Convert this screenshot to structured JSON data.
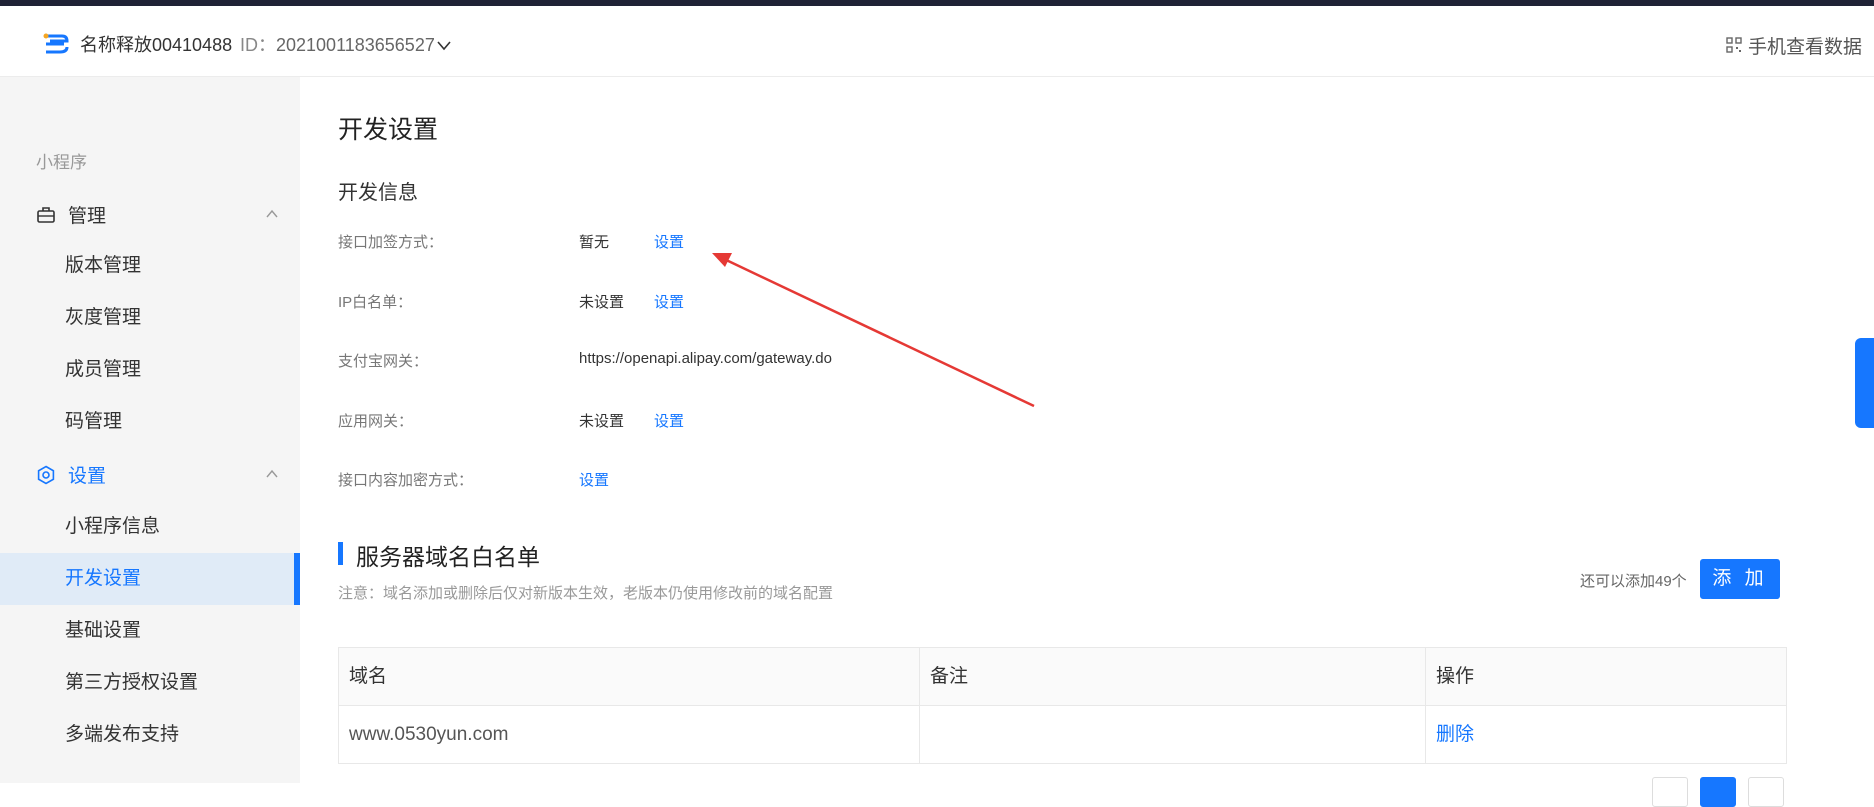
{
  "header": {
    "app_name": "名称释放00410488",
    "id_label": "ID：",
    "id_value": "2021001183656527",
    "mobile_view": "手机查看数据"
  },
  "sidebar": {
    "section": "小程序",
    "groups": [
      {
        "label": "管理",
        "items": [
          "版本管理",
          "灰度管理",
          "成员管理",
          "码管理"
        ]
      },
      {
        "label": "设置",
        "items": [
          "小程序信息",
          "开发设置",
          "基础设置",
          "第三方授权设置",
          "多端发布支持"
        ]
      }
    ],
    "active_item": "开发设置"
  },
  "main": {
    "page_title": "开发设置",
    "dev_info_title": "开发信息",
    "rows": [
      {
        "label": "接口加签方式：",
        "value": "暂无",
        "link": "设置"
      },
      {
        "label": "IP白名单：",
        "value": "未设置",
        "link": "设置"
      },
      {
        "label": "支付宝网关：",
        "value": "https://openapi.alipay.com/gateway.do",
        "link": ""
      },
      {
        "label": "应用网关：",
        "value": "未设置",
        "link": "设置"
      },
      {
        "label": "接口内容加密方式：",
        "value": "",
        "link": "设置"
      }
    ],
    "whitelist": {
      "title": "服务器域名白名单",
      "note": "注意：域名添加或删除后仅对新版本生效，老版本仍使用修改前的域名配置",
      "remaining": "还可以添加49个",
      "add_button": "添 加",
      "columns": [
        "域名",
        "备注",
        "操作"
      ],
      "rows": [
        {
          "domain": "www.0530yun.com",
          "remark": "",
          "action": "删除"
        }
      ]
    }
  },
  "colors": {
    "accent": "#1677ff",
    "arrow": "#e53935",
    "sidebar_bg": "#f5f5f5",
    "active_bg": "#e0ebf7"
  }
}
